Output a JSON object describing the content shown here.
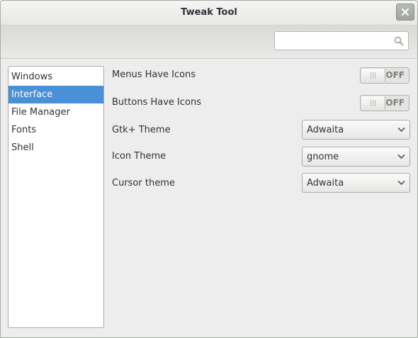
{
  "window": {
    "title": "Tweak Tool"
  },
  "search": {
    "value": "",
    "placeholder": ""
  },
  "sidebar": {
    "items": [
      {
        "label": "Windows"
      },
      {
        "label": "Interface"
      },
      {
        "label": "File Manager"
      },
      {
        "label": "Fonts"
      },
      {
        "label": "Shell"
      }
    ],
    "selected": "Interface"
  },
  "settings": {
    "menus_icons": {
      "label": "Menus Have Icons",
      "state": "OFF"
    },
    "buttons_icons": {
      "label": "Buttons Have Icons",
      "state": "OFF"
    },
    "gtk_theme": {
      "label": "Gtk+ Theme",
      "value": "Adwaita"
    },
    "icon_theme": {
      "label": "Icon Theme",
      "value": "gnome"
    },
    "cursor_theme": {
      "label": "Cursor theme",
      "value": "Adwaita"
    }
  },
  "colors": {
    "selection": "#4a90d9",
    "window_bg": "#ededed"
  },
  "icons": {
    "close": "close-icon",
    "search": "search-icon",
    "dropdown": "chevron-down-icon"
  }
}
